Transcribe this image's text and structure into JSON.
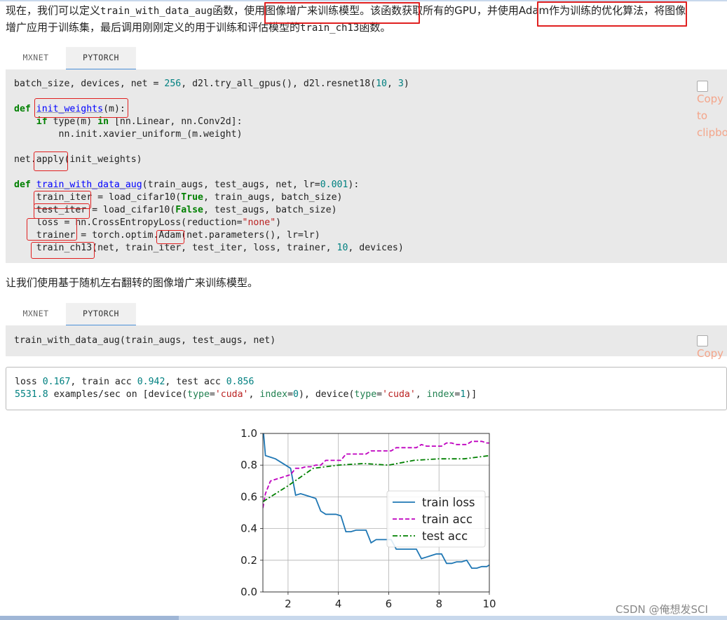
{
  "paragraph1": {
    "line1_a": "现在，我们可以定义",
    "line1_code": "train_with_data_aug",
    "line1_b": "函数，使用图像增广来训练模型。该函数获取所有的GPU，并使用Adam作为训练的优化算法，将图像",
    "line2_a": "增广应用于训练集，最后调用刚刚定义的用于训练和评估模型的",
    "line2_code": "train_ch13",
    "line2_b": "函数。"
  },
  "tabs1": {
    "mxnet": "MXNET",
    "pytorch": "PYTORCH"
  },
  "code1": {
    "l1a": "batch_size, devices, net = ",
    "l1n1": "256",
    "l1b": ", d2l.try_all_gpus(), d2l.resnet18(",
    "l1n2": "10",
    "l1c": ", ",
    "l1n3": "3",
    "l1d": ")",
    "l3kw": "def",
    "l3fn": "init_weights",
    "l3b": "(m):",
    "l4kw1": "if",
    "l4a": " type(m) ",
    "l4kw2": "in",
    "l4b": " [nn.Linear, nn.Conv2d]:",
    "l5": "        nn.init.xavier_uniform_(m.weight)",
    "l7": "net.apply(init_weights)",
    "l9kw": "def",
    "l9fn": "train_with_data_aug",
    "l9a": "(train_augs, test_augs, net, lr=",
    "l9n": "0.001",
    "l9b": "):",
    "l10a": "    train_iter = load_cifar10(",
    "l10kw": "True",
    "l10b": ", train_augs, batch_size)",
    "l11a": "    test_iter = load_cifar10(",
    "l11kw": "False",
    "l11b": ", test_augs, batch_size)",
    "l12a": "    loss = nn.CrossEntropyLoss(reduction=",
    "l12s": "\"none\"",
    "l12b": ")",
    "l13": "    trainer = torch.optim.Adam(net.parameters(), lr=lr)",
    "l14a": "    train_ch13(net, train_iter, test_iter, loss, trainer, ",
    "l14n": "10",
    "l14b": ", devices)"
  },
  "copy_button": {
    "line1": "Copy",
    "line2": "to",
    "line3": "clipbo"
  },
  "paragraph2": "让我们使用基于随机左右翻转的图像增广来训练模型。",
  "tabs2": {
    "mxnet": "MXNET",
    "pytorch": "PYTORCH"
  },
  "code2": {
    "line": "train_with_data_aug(train_augs, test_augs, net)"
  },
  "copy_button2": {
    "line1": "Copy"
  },
  "output": {
    "l1a": "loss ",
    "l1n1": "0.167",
    "l1b": ", train acc ",
    "l1n2": "0.942",
    "l1c": ", test acc ",
    "l1n3": "0.856",
    "l2n": "5531.8",
    "l2a": " examples/sec on [device(",
    "l2kw1": "type",
    "l2b": "=",
    "l2s1": "'cuda'",
    "l2c": ", ",
    "l2kw2": "index",
    "l2d": "=",
    "l2n2": "0",
    "l2e": "), device(",
    "l2kw3": "type",
    "l2f": "=",
    "l2s2": "'cuda'",
    "l2g": ", ",
    "l2kw4": "index",
    "l2h": "=",
    "l2n3": "1",
    "l2i": ")]"
  },
  "chart_data": {
    "type": "line",
    "xlim": [
      1,
      10
    ],
    "ylim": [
      0.0,
      1.0
    ],
    "xticks": [
      "2",
      "4",
      "6",
      "8",
      "10"
    ],
    "yticks": [
      "0.0",
      "0.2",
      "0.4",
      "0.6",
      "0.8",
      "1.0"
    ],
    "grid": true,
    "legend_placement": "center-right",
    "series": [
      {
        "name": "train loss",
        "color": "#1f77b4",
        "style": "solid",
        "x": [
          1.0,
          1.1,
          1.3,
          1.5,
          1.7,
          1.9,
          2.1,
          2.3,
          2.5,
          2.7,
          2.9,
          3.1,
          3.3,
          3.5,
          3.7,
          3.9,
          4.1,
          4.3,
          4.5,
          4.7,
          4.9,
          5.1,
          5.3,
          5.5,
          5.7,
          5.9,
          6.1,
          6.3,
          6.5,
          6.7,
          6.9,
          7.1,
          7.3,
          7.5,
          7.7,
          7.9,
          8.1,
          8.3,
          8.5,
          8.7,
          8.9,
          9.1,
          9.3,
          9.5,
          9.7,
          9.9,
          10.0
        ],
        "y": [
          1.05,
          0.86,
          0.85,
          0.84,
          0.82,
          0.8,
          0.78,
          0.61,
          0.62,
          0.61,
          0.6,
          0.59,
          0.51,
          0.49,
          0.49,
          0.49,
          0.48,
          0.38,
          0.38,
          0.39,
          0.39,
          0.39,
          0.31,
          0.33,
          0.33,
          0.33,
          0.33,
          0.27,
          0.27,
          0.27,
          0.27,
          0.27,
          0.21,
          0.22,
          0.23,
          0.24,
          0.24,
          0.18,
          0.18,
          0.19,
          0.19,
          0.2,
          0.15,
          0.15,
          0.16,
          0.16,
          0.17
        ]
      },
      {
        "name": "train acc",
        "color": "#bf00bf",
        "style": "dashed",
        "x": [
          1.0,
          1.1,
          1.3,
          1.5,
          1.7,
          1.9,
          2.1,
          2.3,
          2.5,
          2.7,
          2.9,
          3.1,
          3.3,
          3.5,
          3.7,
          3.9,
          4.1,
          4.3,
          4.5,
          4.7,
          4.9,
          5.1,
          5.3,
          5.5,
          5.7,
          5.9,
          6.1,
          6.3,
          6.5,
          6.7,
          6.9,
          7.1,
          7.3,
          7.5,
          7.7,
          7.9,
          8.1,
          8.3,
          8.5,
          8.7,
          8.9,
          9.1,
          9.3,
          9.5,
          9.7,
          9.9,
          10.0
        ],
        "y": [
          0.53,
          0.62,
          0.7,
          0.71,
          0.72,
          0.73,
          0.74,
          0.78,
          0.78,
          0.79,
          0.79,
          0.8,
          0.8,
          0.83,
          0.83,
          0.83,
          0.83,
          0.87,
          0.87,
          0.87,
          0.87,
          0.87,
          0.89,
          0.89,
          0.89,
          0.89,
          0.89,
          0.91,
          0.91,
          0.91,
          0.91,
          0.91,
          0.93,
          0.92,
          0.92,
          0.92,
          0.92,
          0.94,
          0.94,
          0.93,
          0.93,
          0.93,
          0.95,
          0.95,
          0.95,
          0.94,
          0.94
        ]
      },
      {
        "name": "test acc",
        "color": "#008000",
        "style": "dashdot",
        "x": [
          1.0,
          2.0,
          3.0,
          4.0,
          5.0,
          6.0,
          7.0,
          8.0,
          9.0,
          10.0
        ],
        "y": [
          0.57,
          0.67,
          0.78,
          0.8,
          0.81,
          0.8,
          0.83,
          0.84,
          0.84,
          0.86
        ]
      }
    ]
  }
}
